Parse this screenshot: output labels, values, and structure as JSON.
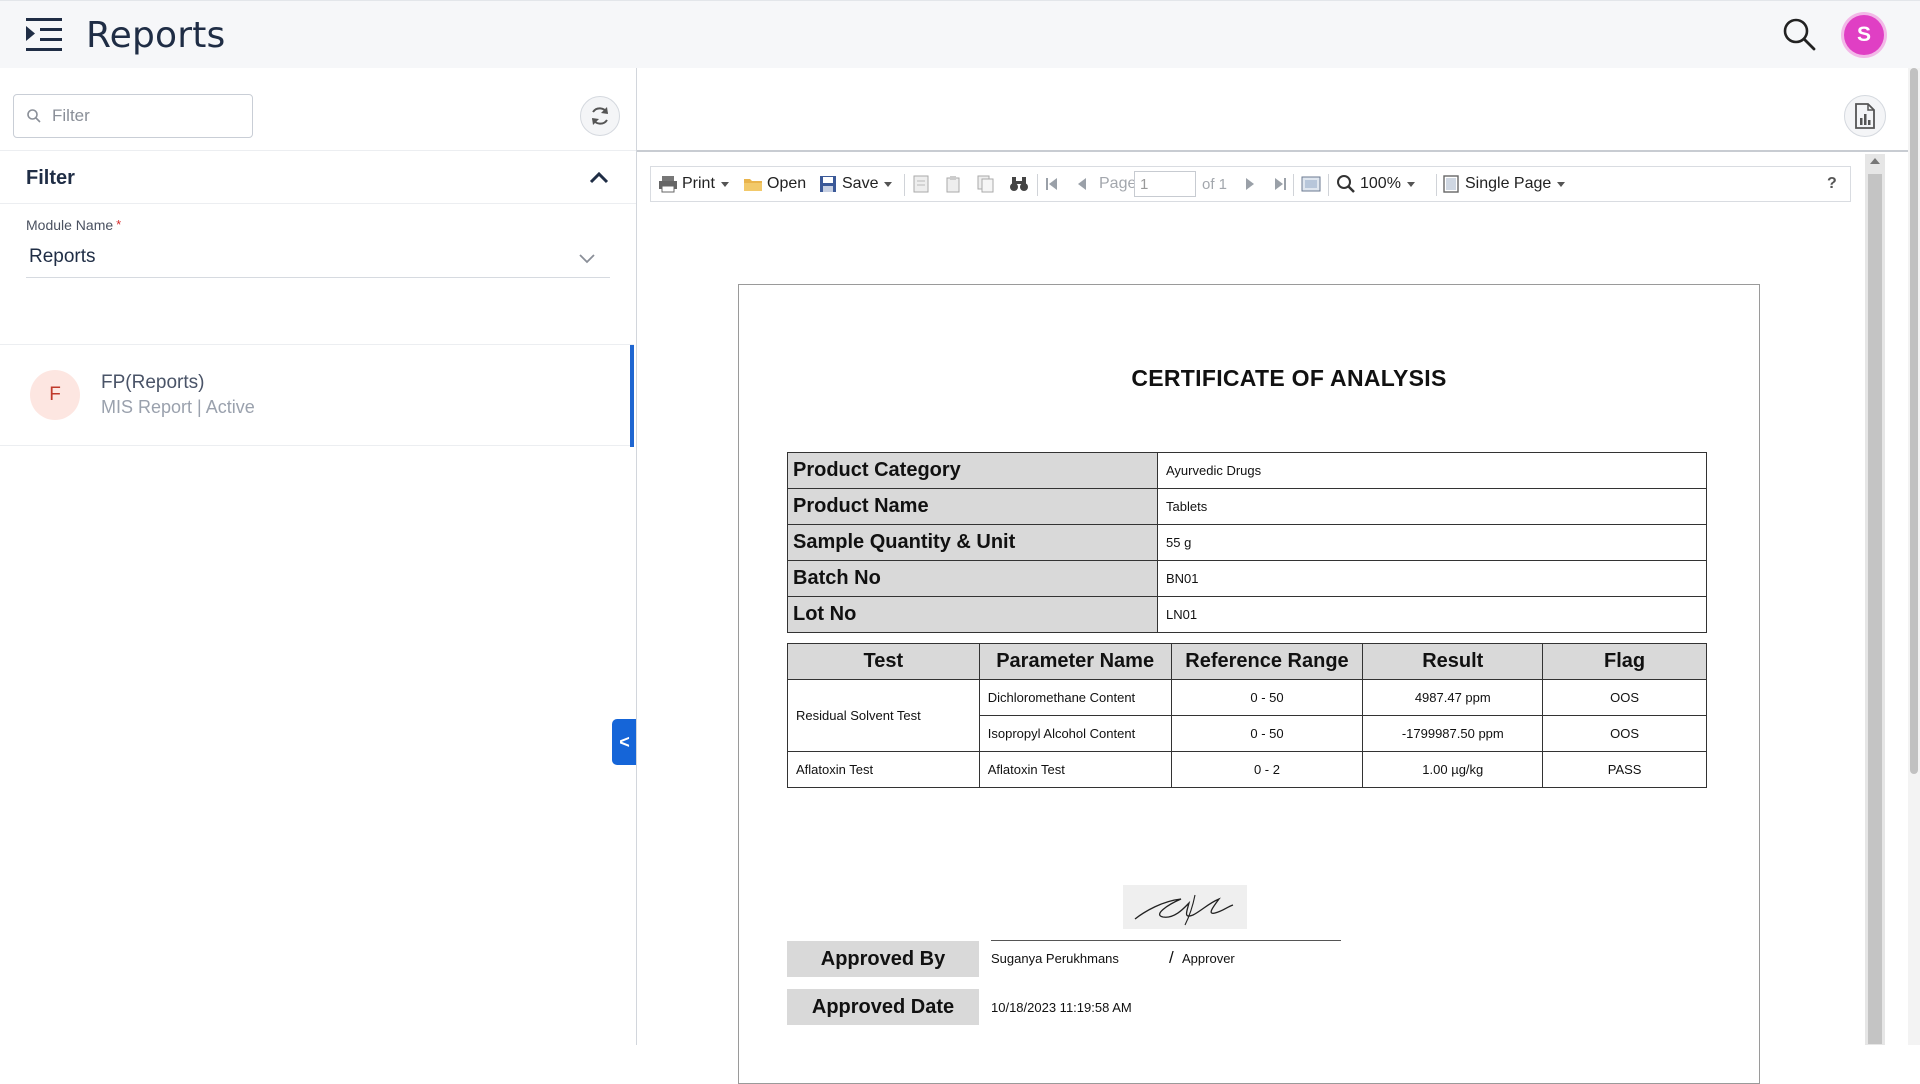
{
  "header": {
    "title": "Reports",
    "avatar_initial": "S",
    "icons": [
      "menu-icon",
      "search-icon"
    ]
  },
  "sidebar": {
    "filter_placeholder": "Filter",
    "filter_section_title": "Filter",
    "module_label": "Module Name",
    "module_required_mark": "*",
    "module_value": "Reports",
    "collapse_label": "<",
    "reports": [
      {
        "initial": "F",
        "name": "FP(Reports)",
        "subtitle": "MIS Report | Active"
      }
    ]
  },
  "viewer": {
    "toolbar": {
      "print": "Print",
      "open": "Open",
      "save": "Save",
      "page_label": "Page",
      "page_value": "1",
      "page_total": "of 1",
      "zoom": "100%",
      "view_mode": "Single Page",
      "help": "?"
    },
    "document": {
      "title": "CERTIFICATE OF ANALYSIS",
      "info": [
        {
          "key": "Product Category",
          "value": "Ayurvedic Drugs"
        },
        {
          "key": "Product Name",
          "value": "Tablets"
        },
        {
          "key": "Sample Quantity & Unit",
          "value": "55 g"
        },
        {
          "key": "Batch No",
          "value": "BN01"
        },
        {
          "key": "Lot No",
          "value": "LN01"
        }
      ],
      "results_headers": [
        "Test",
        "Parameter Name",
        "Reference Range",
        "Result",
        "Flag"
      ],
      "results": [
        {
          "test": "Residual Solvent Test",
          "parameter": "Dichloromethane Content",
          "range": "0 - 50",
          "result": "4987.47 ppm",
          "flag": "OOS"
        },
        {
          "test": "",
          "parameter": "Isopropyl Alcohol Content",
          "range": "0 - 50",
          "result": "-1799987.50 ppm",
          "flag": "OOS"
        },
        {
          "test": "Aflatoxin Test",
          "parameter": "Aflatoxin Test",
          "range": "0 - 2",
          "result": "1.00 µg/kg",
          "flag": "PASS"
        }
      ],
      "approved_by_label": "Approved By",
      "approved_by_name": "Suganya Perukhmans",
      "approved_by_separator": "/",
      "approved_by_role": "Approver",
      "approved_date_label": "Approved Date",
      "approved_date_value": "10/18/2023 11:19:58 AM"
    }
  },
  "colors": {
    "accent": "#1565d8",
    "avatar": "#e03fc4",
    "table_header": "#d9d9d9"
  }
}
